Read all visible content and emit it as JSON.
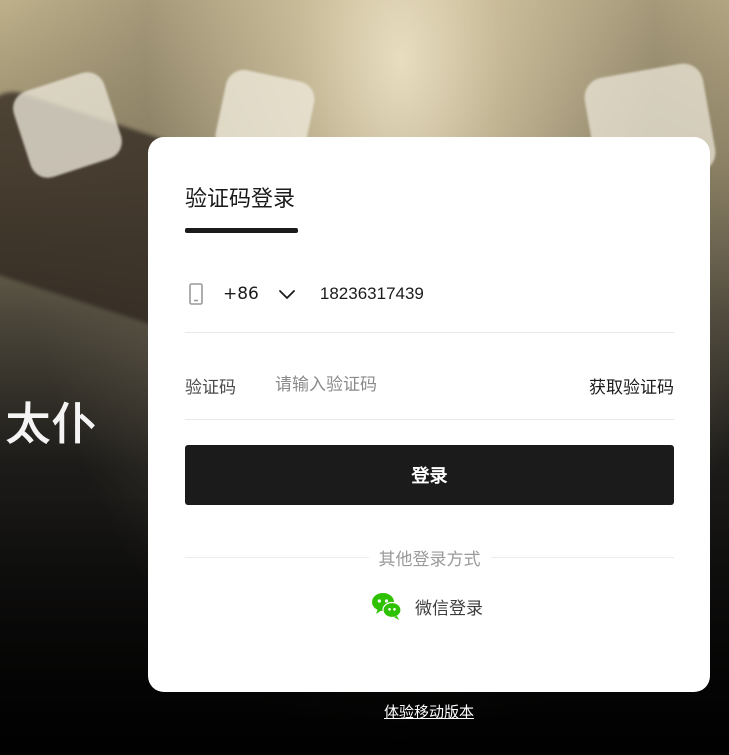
{
  "background": {
    "brand_text": "太仆"
  },
  "card": {
    "tab_label": "验证码登录",
    "phone": {
      "country_code": "+86",
      "number": "18236317439"
    },
    "code": {
      "label": "验证码",
      "placeholder": "请输入验证码",
      "get_code_label": "获取验证码"
    },
    "login_button_label": "登录",
    "other_login_text": "其他登录方式",
    "wechat_label": "微信登录"
  },
  "footer": {
    "mobile_link": "体验移动版本"
  },
  "icons": {
    "phone": "phone-icon",
    "chevron": "chevron-down-icon",
    "wechat": "wechat-icon"
  },
  "colors": {
    "card_bg": "#ffffff",
    "button_bg": "#1b1b1b",
    "wechat_green": "#2DC100",
    "divider": "#e8e8e8"
  }
}
